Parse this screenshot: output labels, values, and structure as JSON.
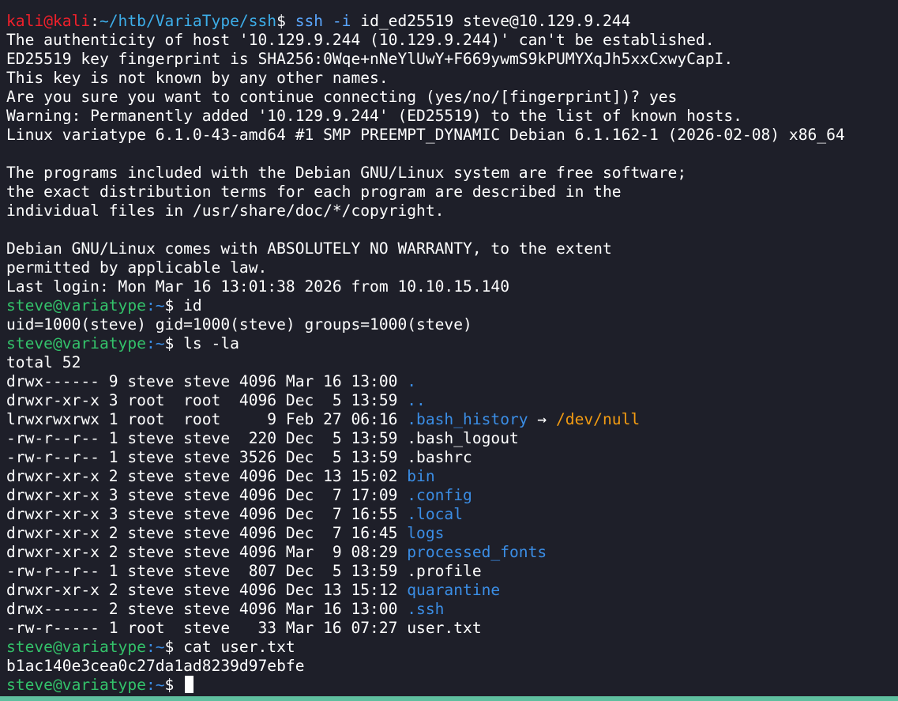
{
  "first_prompt": {
    "user": "kali",
    "at": "@",
    "host": "kali",
    "colon": ":",
    "path": "~/htb/VariaType/ssh",
    "dollar": "$ ",
    "cmd": "ssh",
    "flag": " -i",
    "args": " id_ed25519 steve@10.129.9.244"
  },
  "output_lines": [
    "The authenticity of host '10.129.9.244 (10.129.9.244)' can't be established.",
    "ED25519 key fingerprint is SHA256:0Wqe+nNeYlUwY+F669ywmS9kPUMYXqJh5xxCxwyCapI.",
    "This key is not known by any other names.",
    "Are you sure you want to continue connecting (yes/no/[fingerprint])? yes",
    "Warning: Permanently added '10.129.9.244' (ED25519) to the list of known hosts.",
    "Linux variatype 6.1.0-43-amd64 #1 SMP PREEMPT_DYNAMIC Debian 6.1.162-1 (2026-02-08) x86_64",
    "",
    "The programs included with the Debian GNU/Linux system are free software;",
    "the exact distribution terms for each program are described in the",
    "individual files in /usr/share/doc/*/copyright.",
    "",
    "Debian GNU/Linux comes with ABSOLUTELY NO WARRANTY, to the extent",
    "permitted by applicable law.",
    "Last login: Mon Mar 16 13:01:38 2026 from 10.10.15.140"
  ],
  "prompt": {
    "user_host": "steve@variatype",
    "path": ":~",
    "dollar": "$ "
  },
  "cmd_id": "id",
  "id_output": "uid=1000(steve) gid=1000(steve) groups=1000(steve)",
  "cmd_ls": "ls -la",
  "ls_total": "total 52",
  "ls_rows": [
    {
      "meta": "drwx------ 9 steve steve 4096 Mar 16 13:00 ",
      "name": ".",
      "kind": "dir"
    },
    {
      "meta": "drwxr-xr-x 3 root  root  4096 Dec  5 13:59 ",
      "name": "..",
      "kind": "dir"
    },
    {
      "meta": "lrwxrwxrwx 1 root  root     9 Feb 27 06:16 ",
      "name": ".bash_history",
      "kind": "link",
      "arrow": " → ",
      "target": "/dev/null"
    },
    {
      "meta": "-rw-r--r-- 1 steve steve  220 Dec  5 13:59 ",
      "name": ".bash_logout",
      "kind": "file"
    },
    {
      "meta": "-rw-r--r-- 1 steve steve 3526 Dec  5 13:59 ",
      "name": ".bashrc",
      "kind": "file"
    },
    {
      "meta": "drwxr-xr-x 2 steve steve 4096 Dec 13 15:02 ",
      "name": "bin",
      "kind": "dir"
    },
    {
      "meta": "drwxr-xr-x 3 steve steve 4096 Dec  7 17:09 ",
      "name": ".config",
      "kind": "dir"
    },
    {
      "meta": "drwxr-xr-x 3 steve steve 4096 Dec  7 16:55 ",
      "name": ".local",
      "kind": "dir"
    },
    {
      "meta": "drwxr-xr-x 2 steve steve 4096 Dec  7 16:45 ",
      "name": "logs",
      "kind": "dir"
    },
    {
      "meta": "drwxr-xr-x 2 steve steve 4096 Mar  9 08:29 ",
      "name": "processed_fonts",
      "kind": "dir"
    },
    {
      "meta": "-rw-r--r-- 1 steve steve  807 Dec  5 13:59 ",
      "name": ".profile",
      "kind": "file"
    },
    {
      "meta": "drwxr-xr-x 2 steve steve 4096 Dec 13 15:12 ",
      "name": "quarantine",
      "kind": "dir"
    },
    {
      "meta": "drwx------ 2 steve steve 4096 Mar 16 13:00 ",
      "name": ".ssh",
      "kind": "dir"
    },
    {
      "meta": "-rw-r----- 1 root  steve   33 Mar 16 07:27 ",
      "name": "user.txt",
      "kind": "file"
    }
  ],
  "cmd_cat": "cat user.txt",
  "cat_output": "b1ac140e3cea0c27da1ad8239d97ebfe",
  "colors": {
    "background": "#1e1f29",
    "prompt_red": "#f0202b",
    "prompt_green": "#33c26a",
    "dir_blue": "#3b8ee6",
    "link_orange": "#f39c12",
    "statusbar": "#5fbf9f"
  }
}
